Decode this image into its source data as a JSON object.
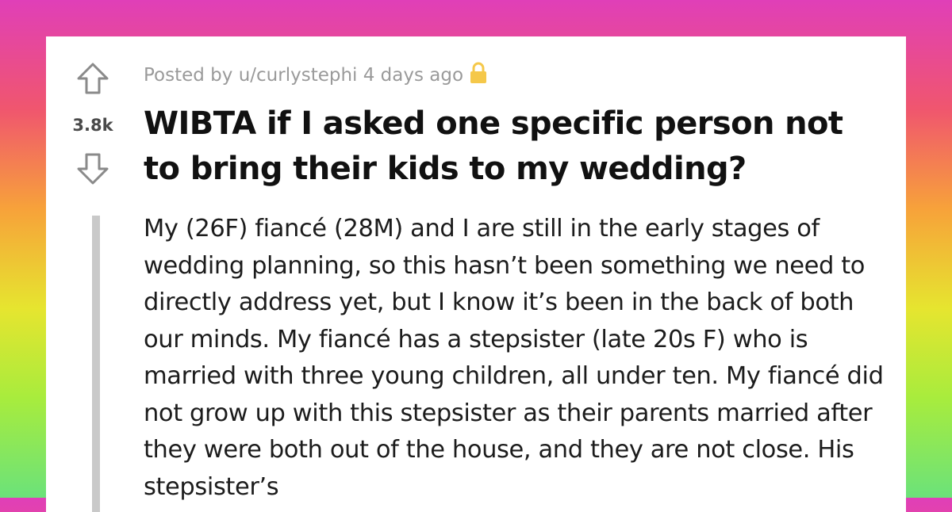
{
  "post": {
    "score": "3.8k",
    "meta": "Posted by u/curlystephi 4 days ago",
    "title": "WIBTA if I asked one specific person not to bring their kids to my wedding?",
    "body": "My (26F) fiancé (28M) and I are still in the early stages of wedding planning, so this hasn’t been something we need to directly address yet, but I know it’s been in the back of both our minds. My fiancé has a stepsister (late 20s F) who is married with three young children, all under ten. My fiancé did not grow up with this stepsister as their parents married after they were both out of the house, and they are not close. His stepsister’s"
  },
  "icons": {
    "upvote": "up-arrow-icon",
    "downvote": "down-arrow-icon",
    "lock": "lock-icon"
  },
  "colors": {
    "lock": "#f5c84a",
    "vote_arrow": "#8a8a8a",
    "quote_bar": "#c9c9c9"
  }
}
